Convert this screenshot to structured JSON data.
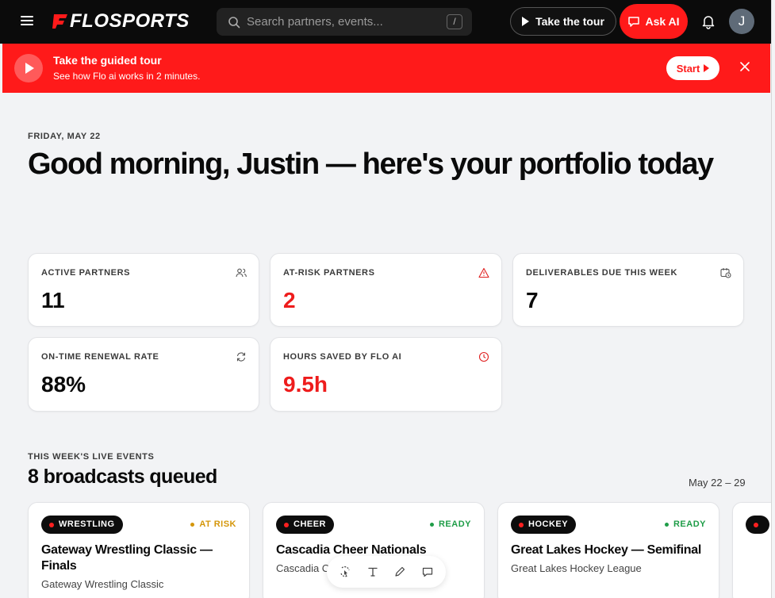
{
  "nav": {
    "logo_text": "FLOSPORTS",
    "search_placeholder": "Search partners, events...",
    "search_shortcut": "/",
    "tour_label": "Take the tour",
    "ask_label": "Ask AI",
    "avatar_initial": "J"
  },
  "banner": {
    "title": "Take the guided tour",
    "subtitle": "See how Flo ai works in 2 minutes.",
    "start_label": "Start"
  },
  "greeting": {
    "date": "FRIDAY, MAY 22",
    "headline": "Good morning, Justin — here's your portfolio today"
  },
  "stats": [
    {
      "label": "ACTIVE PARTNERS",
      "value": "11",
      "icon": "users-icon"
    },
    {
      "label": "AT-RISK PARTNERS",
      "value": "2",
      "icon": "warning-icon"
    },
    {
      "label": "DELIVERABLES DUE THIS WEEK",
      "value": "7",
      "icon": "calendar-clock-icon"
    },
    {
      "label": "ON-TIME RENEWAL RATE",
      "value": "88%",
      "icon": "refresh-icon"
    },
    {
      "label": "HOURS SAVED BY FLO AI",
      "value": "9.5h",
      "icon": "clock-icon"
    }
  ],
  "events_section": {
    "kicker": "THIS WEEK'S LIVE EVENTS",
    "title": "8 broadcasts queued",
    "range": "May 22 – 29"
  },
  "events": [
    {
      "sport": "WRESTLING",
      "status": "AT RISK",
      "title": "Gateway Wrestling Classic — Finals",
      "league": "Gateway Wrestling Classic"
    },
    {
      "sport": "CHEER",
      "status": "READY",
      "title": "Cascadia Cheer Nationals",
      "league": "Cascadia C"
    },
    {
      "sport": "HOCKEY",
      "status": "READY",
      "title": "Great Lakes Hockey — Semifinal",
      "league": "Great Lakes Hockey League"
    }
  ],
  "colors": {
    "brand_red": "#ff1a1a",
    "at_risk": "#d4960a",
    "ready": "#1f9d48"
  }
}
